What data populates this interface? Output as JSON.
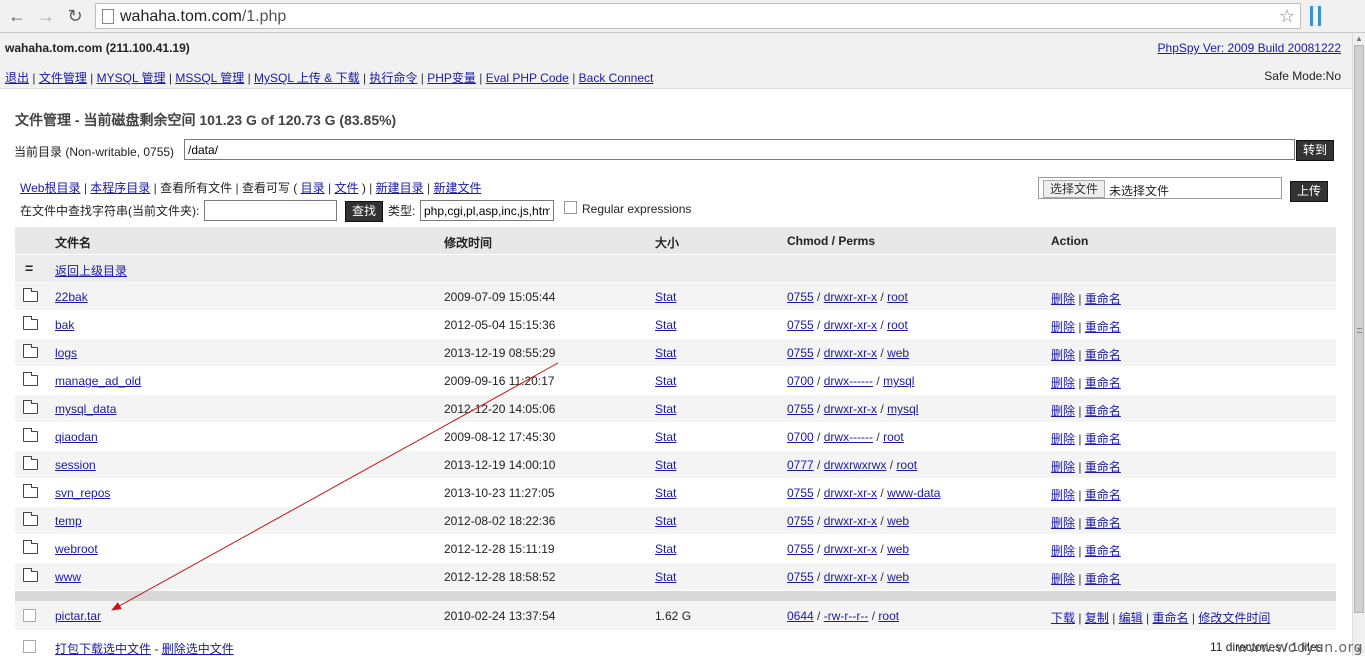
{
  "browser": {
    "url_host": "wahaha.tom.com",
    "url_path": "/1.php"
  },
  "header": {
    "host": "wahaha.tom.com (211.100.41.19)",
    "version": "PhpSpy Ver: 2009 Build 20081222",
    "safe_mode": "Safe Mode:No",
    "nav": [
      "退出",
      "文件管理",
      "MYSQL 管理",
      "MSSQL 管理",
      "MySQL 上传 & 下载",
      "执行命令",
      "PHP变量",
      "Eval PHP Code",
      "Back Connect"
    ]
  },
  "heading": {
    "title": "文件管理 - 当前磁盘剩余空间 101.23 G of 120.73 G (83.85%)"
  },
  "curdir": {
    "label": "当前目录 (Non-writable, 0755)",
    "value": "/data/",
    "button": "转到"
  },
  "links": {
    "web_root": "Web根目录",
    "script_dir": "本程序目录",
    "view_all": "查看所有文件",
    "writable_prefix": "查看可写 (",
    "dirs": "目录",
    "files": "文件",
    "writable_suffix": ")",
    "new_dir": "新建目录",
    "new_file": "新建文件"
  },
  "search": {
    "label": "在文件中查找字符串(当前文件夹):",
    "value": "",
    "button": "查找",
    "type_label": "类型:",
    "type_value": "php,cgi,pl,asp,inc,js,htm",
    "regex_label": "Regular expressions"
  },
  "upload": {
    "choose": "选择文件",
    "no_file": "未选择文件",
    "button": "上传"
  },
  "table": {
    "headers": {
      "name": "文件名",
      "time": "修改时间",
      "size": "大小",
      "perm": "Chmod / Perms",
      "action": "Action"
    },
    "parent": "返回上级目录",
    "stat_label": "Stat",
    "delete_label": "删除",
    "rename_label": "重命名",
    "dirs": [
      {
        "name": "22bak",
        "time": "2009-07-09 15:05:44",
        "chmod": "0755",
        "perms": "drwxr-xr-x",
        "owner": "root"
      },
      {
        "name": "bak",
        "time": "2012-05-04 15:15:36",
        "chmod": "0755",
        "perms": "drwxr-xr-x",
        "owner": "root"
      },
      {
        "name": "logs",
        "time": "2013-12-19 08:55:29",
        "chmod": "0755",
        "perms": "drwxr-xr-x",
        "owner": "web"
      },
      {
        "name": "manage_ad_old",
        "time": "2009-09-16 11:20:17",
        "chmod": "0700",
        "perms": "drwx------",
        "owner": "mysql"
      },
      {
        "name": "mysql_data",
        "time": "2012-12-20 14:05:06",
        "chmod": "0755",
        "perms": "drwxr-xr-x",
        "owner": "mysql"
      },
      {
        "name": "qiaodan",
        "time": "2009-08-12 17:45:30",
        "chmod": "0700",
        "perms": "drwx------",
        "owner": "root"
      },
      {
        "name": "session",
        "time": "2013-12-19 14:00:10",
        "chmod": "0777",
        "perms": "drwxrwxrwx",
        "owner": "root"
      },
      {
        "name": "svn_repos",
        "time": "2013-10-23 11:27:05",
        "chmod": "0755",
        "perms": "drwxr-xr-x",
        "owner": "www-data"
      },
      {
        "name": "temp",
        "time": "2012-08-02 18:22:36",
        "chmod": "0755",
        "perms": "drwxr-xr-x",
        "owner": "web"
      },
      {
        "name": "webroot",
        "time": "2012-12-28 15:11:19",
        "chmod": "0755",
        "perms": "drwxr-xr-x",
        "owner": "web"
      },
      {
        "name": "www",
        "time": "2012-12-28 18:58:52",
        "chmod": "0755",
        "perms": "drwxr-xr-x",
        "owner": "web"
      }
    ],
    "file": {
      "name": "pictar.tar",
      "time": "2010-02-24 13:37:54",
      "size": "1.62 G",
      "chmod": "0644",
      "perms": "-rw-r--r--",
      "owner": "root",
      "actions": [
        "下载",
        "复制",
        "编辑",
        "重命名",
        "修改文件时间"
      ]
    },
    "footer": {
      "pack_download": "打包下载选中文件",
      "dash": "-",
      "delete_selected": "删除选中文件",
      "summary": "11 directories / 1 files"
    }
  },
  "watermark": "www.wooyun.org",
  "colors": {
    "link": "#1a1aa6",
    "arrow": "#cc1111",
    "button_bg": "#333333"
  }
}
